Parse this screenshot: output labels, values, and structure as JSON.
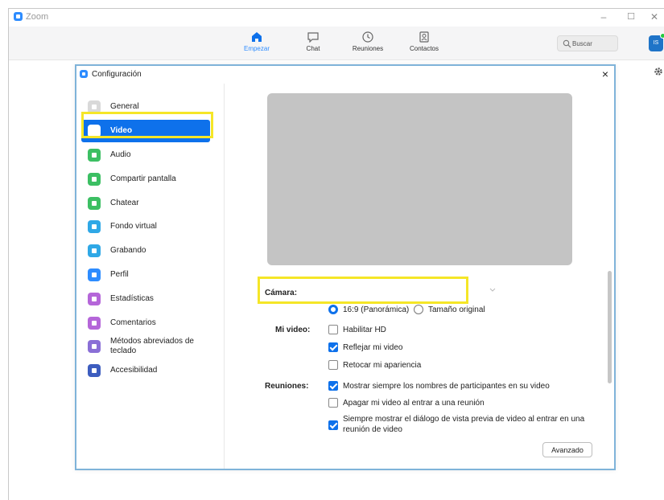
{
  "app": {
    "title": "Zoom",
    "window_controls": {
      "minimize": "–",
      "maximize": "☐",
      "close": "✕"
    }
  },
  "toolbar": {
    "nav": [
      {
        "label": "Empezar",
        "icon": "home-icon",
        "active": true
      },
      {
        "label": "Chat",
        "icon": "chat-icon",
        "active": false
      },
      {
        "label": "Reuniones",
        "icon": "clock-icon",
        "active": false
      },
      {
        "label": "Contactos",
        "icon": "contacts-icon",
        "active": false
      }
    ],
    "search_placeholder": "Buscar",
    "avatar_initials": "IS"
  },
  "dialog": {
    "title": "Configuración",
    "close": "×",
    "sidebar": [
      {
        "label": "General",
        "icon": "general-icon",
        "color": "#d9d9d9",
        "active": false
      },
      {
        "label": "Video",
        "icon": "video-icon",
        "color": "#ffffff",
        "active": true
      },
      {
        "label": "Audio",
        "icon": "headphones-icon",
        "color": "#3cbf63",
        "active": false
      },
      {
        "label": "Compartir pantalla",
        "icon": "share-screen-icon",
        "color": "#3cbf63",
        "active": false
      },
      {
        "label": "Chatear",
        "icon": "chat-bubble-icon",
        "color": "#3cbf63",
        "active": false
      },
      {
        "label": "Fondo virtual",
        "icon": "virtual-background-icon",
        "color": "#2fa8e6",
        "active": false
      },
      {
        "label": "Grabando",
        "icon": "record-icon",
        "color": "#2fa8e6",
        "active": false
      },
      {
        "label": "Perfil",
        "icon": "profile-icon",
        "color": "#2d8cff",
        "active": false
      },
      {
        "label": "Estadísticas",
        "icon": "statistics-icon",
        "color": "#b566d9",
        "active": false
      },
      {
        "label": "Comentarios",
        "icon": "feedback-icon",
        "color": "#b566d9",
        "active": false
      },
      {
        "label": "Métodos abreviados de teclado",
        "icon": "keyboard-icon",
        "color": "#8a6fd6",
        "active": false
      },
      {
        "label": "Accesibilidad",
        "icon": "accessibility-icon",
        "color": "#3d5dbf",
        "active": false
      }
    ],
    "camera_label": "Cámara:",
    "camera_value": "",
    "aspect": [
      {
        "label": "16:9 (Panorámica)",
        "checked": true
      },
      {
        "label": "Tamaño original",
        "checked": false
      }
    ],
    "mi_video_label": "Mi video:",
    "mi_video": [
      {
        "label": "Habilitar HD",
        "checked": false
      },
      {
        "label": "Reflejar mi video",
        "checked": true
      },
      {
        "label": "Retocar mi apariencia",
        "checked": false
      }
    ],
    "reuniones_label": "Reuniones:",
    "reuniones": [
      {
        "label": "Mostrar siempre los nombres de participantes en su video",
        "checked": true
      },
      {
        "label": "Apagar mi video al entrar a una reunión",
        "checked": false
      },
      {
        "label": "Siempre mostrar el diálogo de vista previa de video al entrar en una",
        "label2": "reunión de video",
        "checked": true
      }
    ],
    "advanced_button": "Avanzado"
  },
  "colors": {
    "accent": "#0e71eb",
    "highlight": "#f5e627",
    "preview": "#c4c4c4"
  }
}
